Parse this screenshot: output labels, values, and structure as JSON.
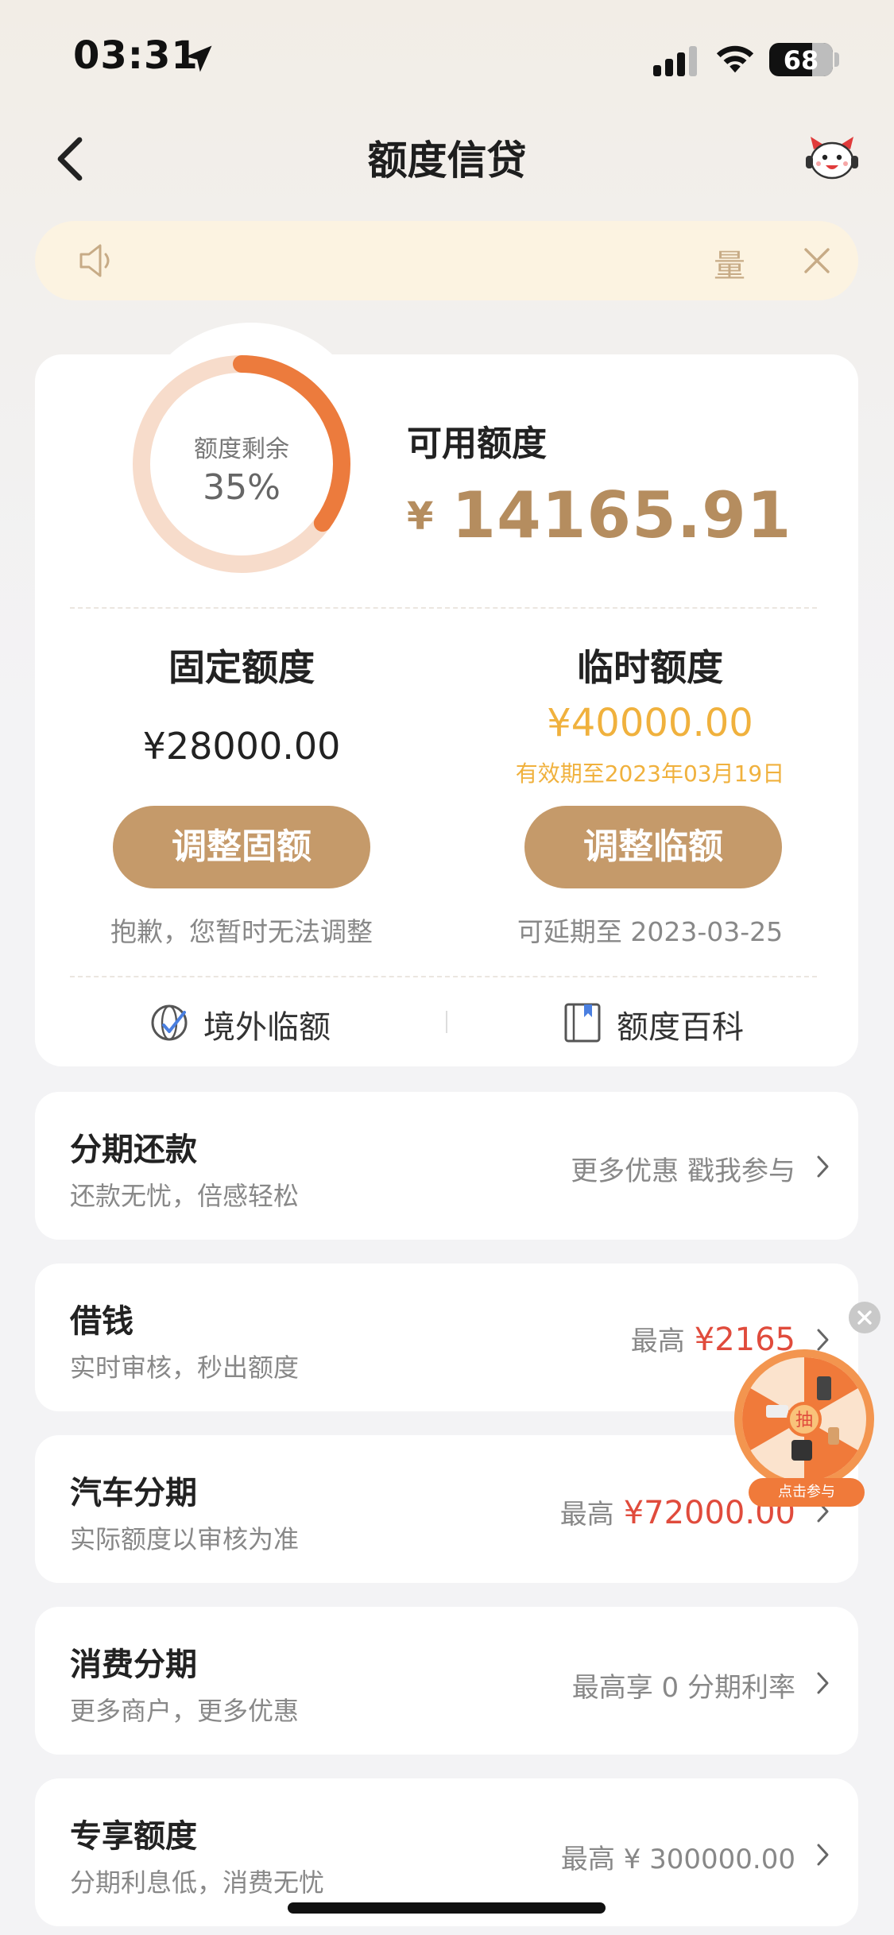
{
  "status_bar": {
    "time": "03:31",
    "battery": "68"
  },
  "nav": {
    "title": "额度信贷"
  },
  "notice": {
    "text": "量"
  },
  "credit": {
    "ring_label": "额度剩余",
    "ring_percent": "35%",
    "ring_fraction": 0.35,
    "available_label": "可用额度",
    "available_currency": "¥",
    "available_amount": "14165.91",
    "fixed": {
      "title": "固定额度",
      "amount": "¥28000.00",
      "button": "调整固额",
      "note": "抱歉，您暂时无法调整"
    },
    "temp": {
      "title": "临时额度",
      "amount": "¥40000.00",
      "valid": "有效期至2023年03月19日",
      "button": "调整临额",
      "note": "可延期至 2023-03-25"
    },
    "links": {
      "overseas": "境外临额",
      "wiki": "额度百科"
    }
  },
  "list": [
    {
      "title": "分期还款",
      "sub": "还款无忧，倍感轻松",
      "right": "更多优惠 戳我参与",
      "highlight": ""
    },
    {
      "title": "借钱",
      "sub": "实时审核，秒出额度",
      "right": "最高",
      "highlight": "¥2165"
    },
    {
      "title": "汽车分期",
      "sub": "实际额度以审核为准",
      "right": "最高",
      "highlight": "¥72000.00"
    },
    {
      "title": "消费分期",
      "sub": "更多商户，更多优惠",
      "right": "最高享 0 分期利率",
      "highlight": ""
    },
    {
      "title": "专享额度",
      "sub": "分期利息低，消费无忧",
      "right": "最高 ¥ 300000.00",
      "highlight": ""
    }
  ],
  "float_widget": {
    "center": "抽",
    "banner": "点击参与"
  },
  "colors": {
    "accent_gold": "#c59a6a",
    "ring_orange": "#ec7b3d",
    "temp_yellow": "#f0b13d",
    "price_red": "#e04b3c"
  },
  "icons": [
    "location-arrow-icon",
    "signal-icon",
    "wifi-icon",
    "back-chevron-icon",
    "service-avatar-icon",
    "speaker-icon",
    "close-icon",
    "globe-icon",
    "book-icon",
    "chevron-right-icon"
  ]
}
